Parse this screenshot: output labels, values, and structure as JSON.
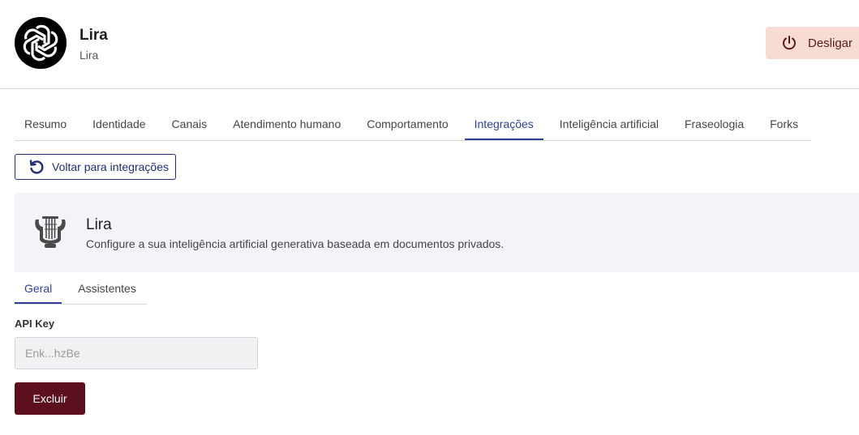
{
  "header": {
    "bot_name": "Lira",
    "bot_subtitle": "Lira",
    "avatar_icon": "openai-logo-icon",
    "power_button_label": "Desligar",
    "power_button_icon": "power-icon"
  },
  "tabs": [
    {
      "label": "Resumo",
      "active": false
    },
    {
      "label": "Identidade",
      "active": false
    },
    {
      "label": "Canais",
      "active": false
    },
    {
      "label": "Atendimento humano",
      "active": false
    },
    {
      "label": "Comportamento",
      "active": false
    },
    {
      "label": "Integrações",
      "active": true
    },
    {
      "label": "Inteligência artificial",
      "active": false
    },
    {
      "label": "Fraseologia",
      "active": false
    },
    {
      "label": "Forks",
      "active": false
    }
  ],
  "back_button": {
    "label": "Voltar para integrações",
    "icon": "undo-icon"
  },
  "integration": {
    "icon": "lyre-icon",
    "title": "Lira",
    "description": "Configure a sua inteligência artificial generativa baseada em documentos privados."
  },
  "subtabs": [
    {
      "label": "Geral",
      "active": true
    },
    {
      "label": "Assistentes",
      "active": false
    }
  ],
  "form": {
    "api_key_label": "API Key",
    "api_key_value": "Enk...hzBe",
    "delete_button_label": "Excluir"
  },
  "colors": {
    "accent": "#2f3fa0",
    "back_button_border": "#1f2d7a",
    "power_button_bg": "#f8dcd4",
    "delete_button_bg": "#5c0f1f",
    "banner_bg": "#f3f4f7"
  }
}
